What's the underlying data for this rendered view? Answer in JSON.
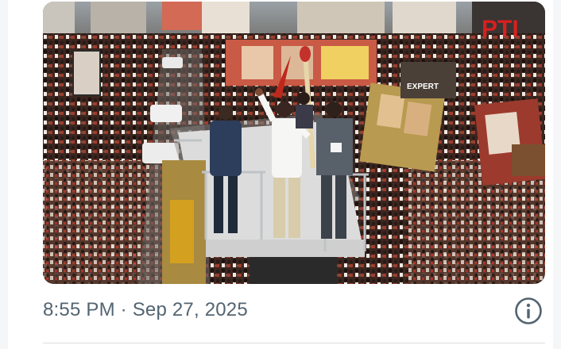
{
  "post": {
    "timestamp": "8:55 PM · Sep 27, 2025"
  },
  "media": {
    "kind": "photo",
    "overlay_text": "PTI",
    "banner_text": "EXPERT"
  },
  "icons": {
    "info": "info-circle-icon"
  },
  "colors": {
    "text_secondary": "#536471",
    "divider": "#d8dde1",
    "background": "#ffffff"
  }
}
